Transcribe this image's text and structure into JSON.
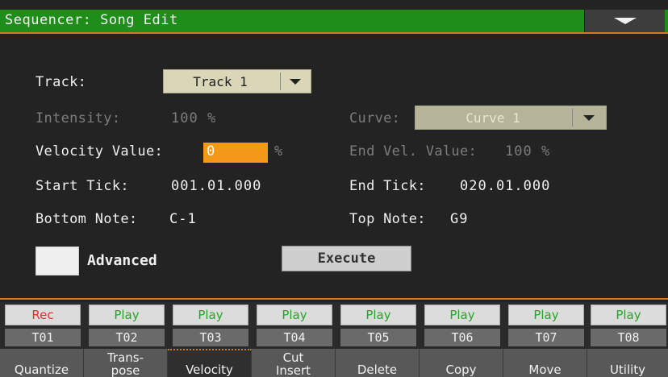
{
  "title": "Sequencer: Song Edit",
  "icons": {
    "menu": "triangle-down-icon",
    "dropdown": "triangle-down-icon",
    "checkbox": "checkbox"
  },
  "colors": {
    "title_bar": "#1f8d1a",
    "accent": "#d07a1a",
    "value_highlight": "#f29a18",
    "play": "#27a52b",
    "rec": "#e12d2d"
  },
  "form": {
    "track_label": "Track:",
    "track_value": "Track 1",
    "intensity_label": "Intensity:",
    "intensity_value": "100 %",
    "curve_label": "Curve:",
    "curve_value": "Curve 1",
    "velocity_label": "Velocity Value:",
    "velocity_value": "0",
    "velocity_unit": "%",
    "end_vel_label": "End Vel. Value:",
    "end_vel_value": "100 %",
    "start_tick_label": "Start Tick:",
    "start_tick_value": "001.01.000",
    "end_tick_label": "End Tick:",
    "end_tick_value": "020.01.000",
    "bottom_note_label": "Bottom Note:",
    "bottom_note_value": "C-1",
    "top_note_label": "Top Note:",
    "top_note_value": "G9",
    "advanced_label": "Advanced",
    "advanced_checked": false,
    "execute_label": "Execute"
  },
  "tracks": [
    {
      "state": "Rec",
      "name": "T01"
    },
    {
      "state": "Play",
      "name": "T02"
    },
    {
      "state": "Play",
      "name": "T03"
    },
    {
      "state": "Play",
      "name": "T04"
    },
    {
      "state": "Play",
      "name": "T05"
    },
    {
      "state": "Play",
      "name": "T06"
    },
    {
      "state": "Play",
      "name": "T07"
    },
    {
      "state": "Play",
      "name": "T08"
    }
  ],
  "tabs": [
    {
      "lines": [
        "Quantize"
      ]
    },
    {
      "lines": [
        "Trans-",
        "pose"
      ]
    },
    {
      "lines": [
        "Velocity"
      ],
      "active": true
    },
    {
      "lines": [
        "Cut",
        "Insert"
      ]
    },
    {
      "lines": [
        "Delete"
      ]
    },
    {
      "lines": [
        "Copy"
      ]
    },
    {
      "lines": [
        "Move"
      ]
    },
    {
      "lines": [
        "Utility"
      ]
    }
  ]
}
